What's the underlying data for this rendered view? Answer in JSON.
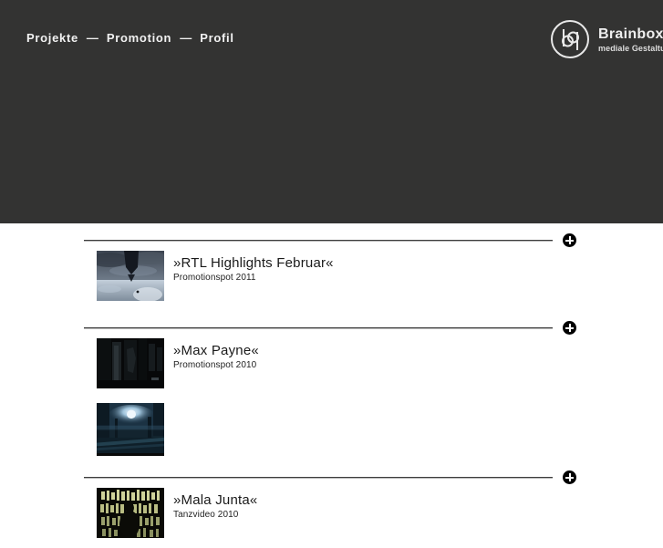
{
  "theme": {
    "header_bg": "#333332",
    "page_bg": "#ffffff",
    "rule_color": "#3d3d3d",
    "plus_bg": "#000000",
    "plus_glyph": "#ffffff",
    "nav_text": "#f2f2f2",
    "title_text": "#1a1a1a"
  },
  "nav": {
    "items": [
      {
        "label": "Projekte"
      },
      {
        "label": "Promotion"
      },
      {
        "label": "Profil"
      }
    ],
    "separator": "—"
  },
  "brand": {
    "mark": "brainbox-bq-circle-logo",
    "name": "Brainbox",
    "tagline": "mediale Gestaltung"
  },
  "list": {
    "expand_icon": "plus-icon",
    "rows": [
      {
        "has_rule": true,
        "thumb": "rtl-highlights-storm-tower",
        "title": "»RTL Highlights Februar«",
        "subtitle": "Promotionspot 2011"
      },
      {
        "has_rule": true,
        "thumb": "max-payne-dark-alley",
        "title": "»Max Payne«",
        "subtitle": "Promotionspot 2010"
      },
      {
        "has_rule": false,
        "thumb": "blue-night-road-moon",
        "title": "",
        "subtitle": ""
      },
      {
        "has_rule": true,
        "thumb": "mala-junta-window-lights",
        "title": "»Mala Junta«",
        "subtitle": "Tanzvideo 2010"
      }
    ]
  }
}
